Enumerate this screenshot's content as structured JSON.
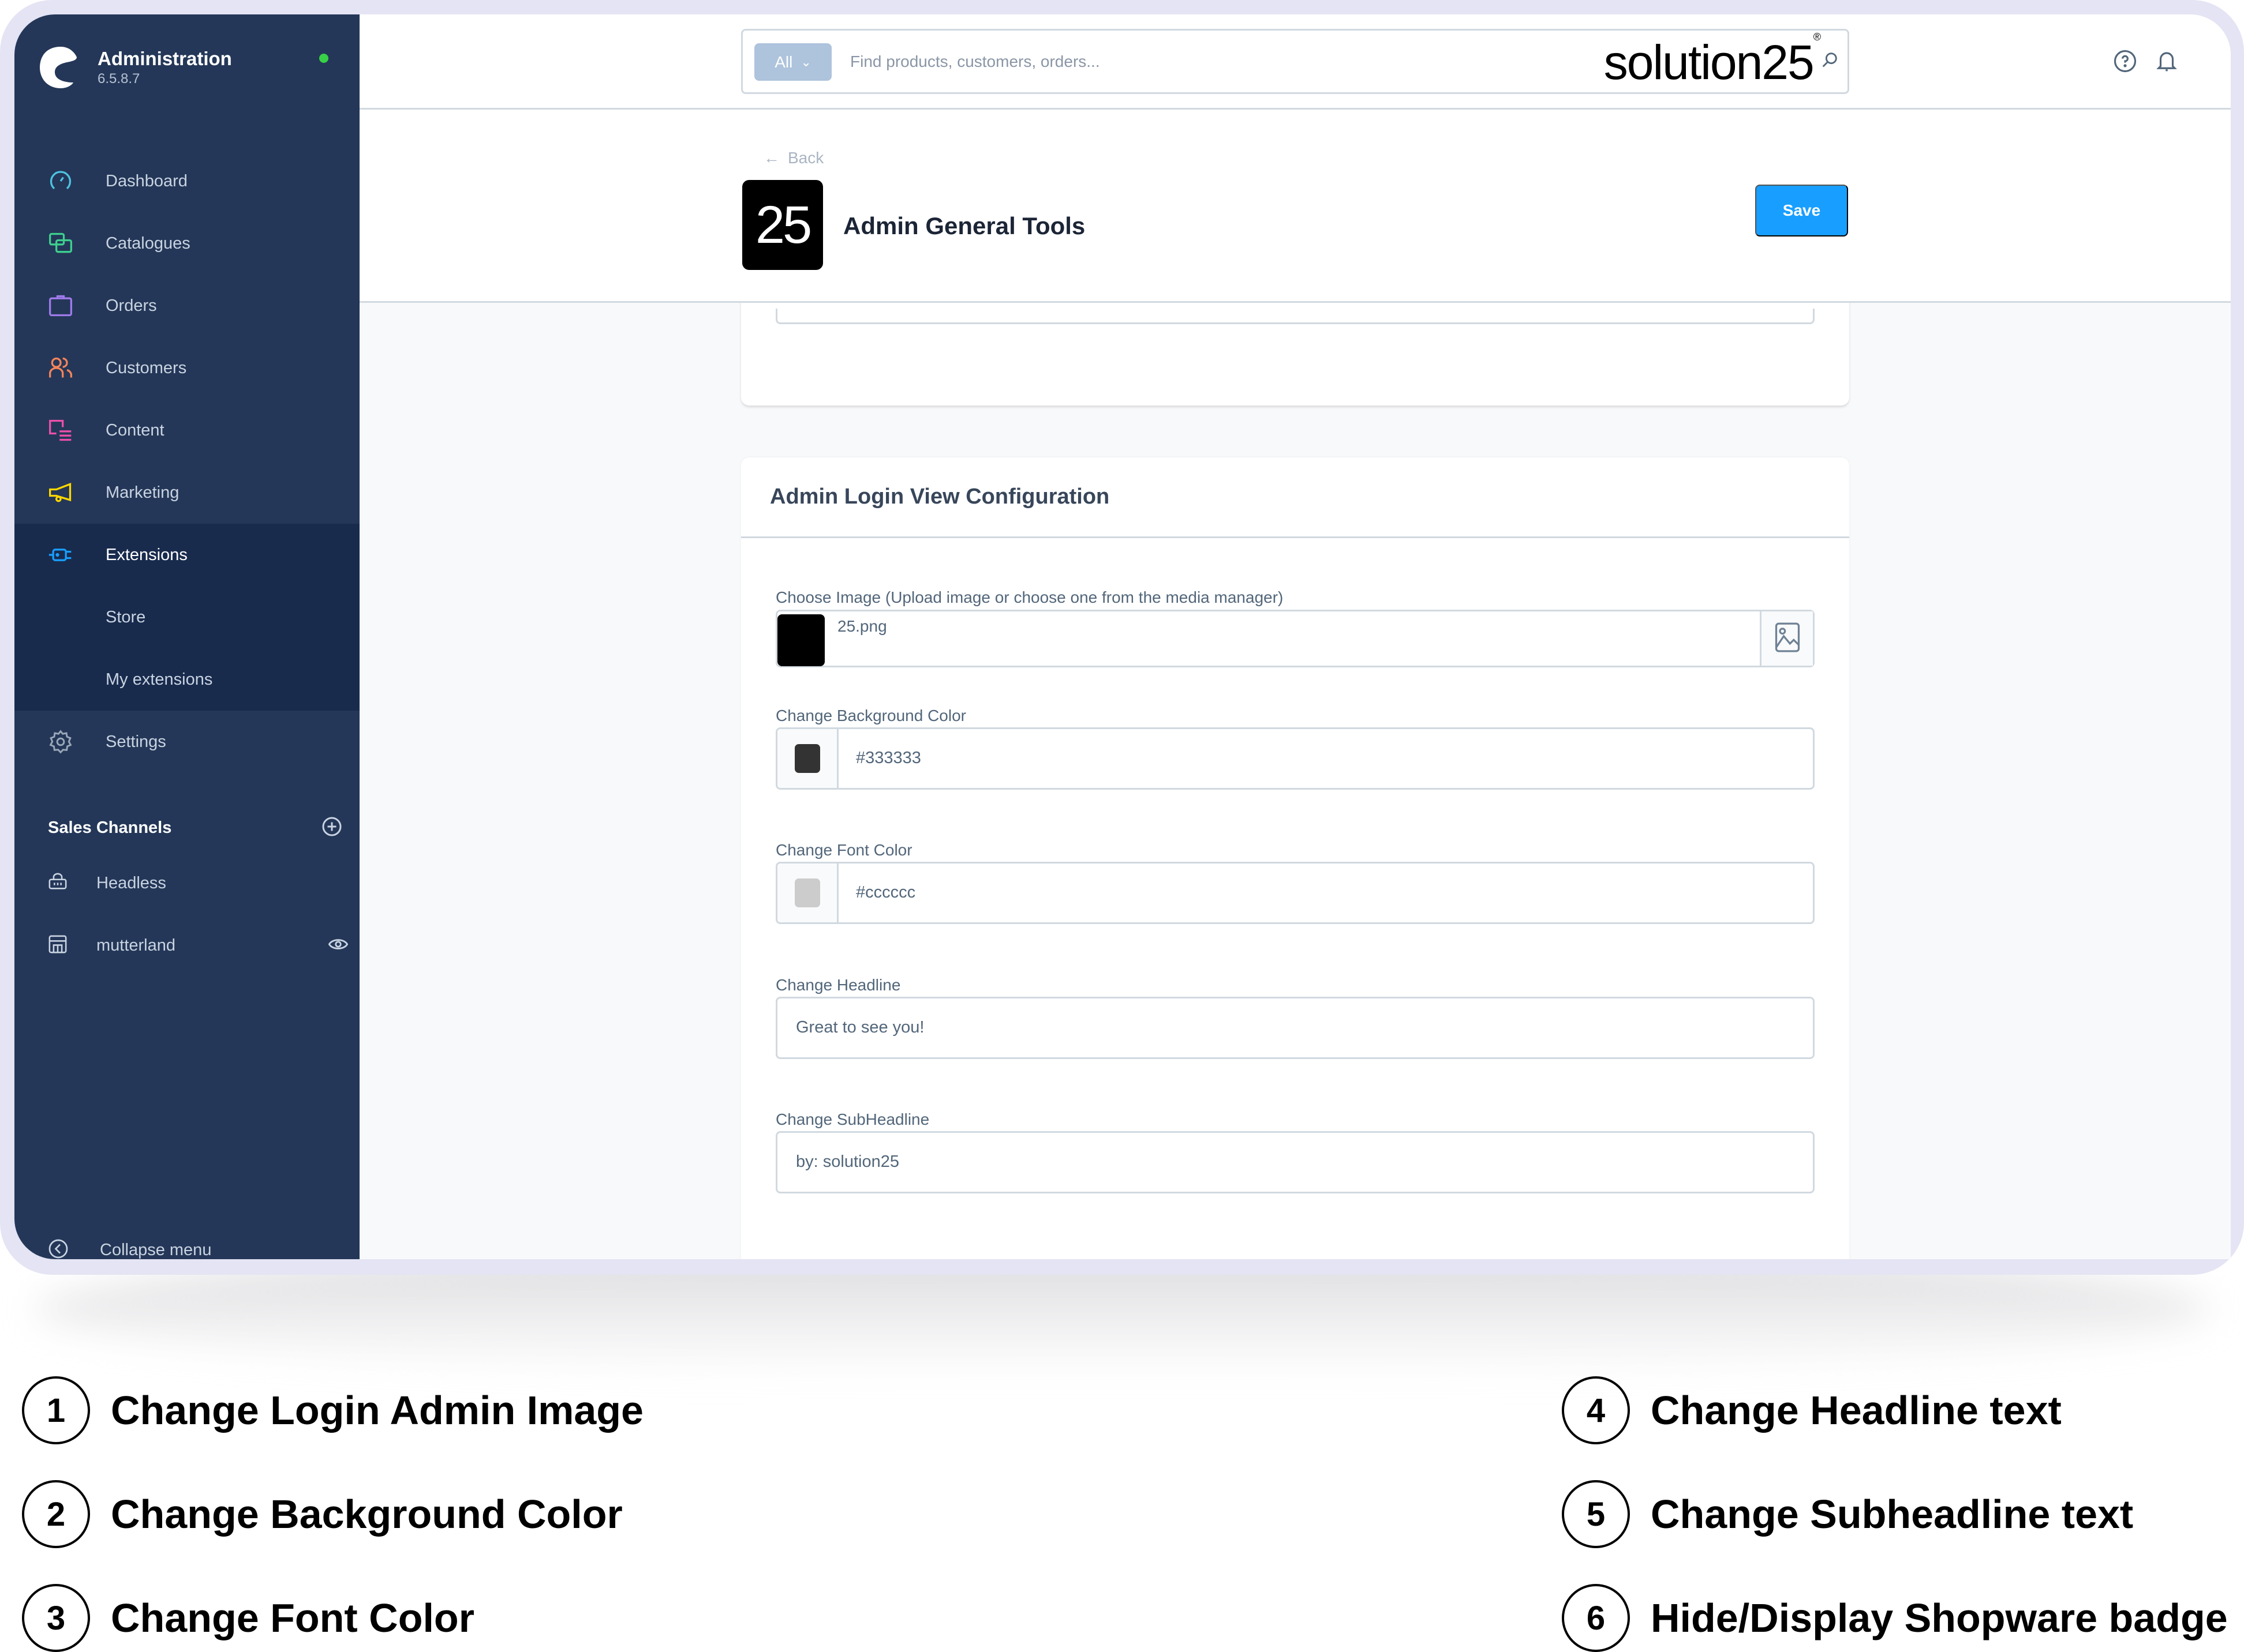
{
  "app": {
    "title": "Administration",
    "version": "6.5.8.7",
    "status_color": "#37d046"
  },
  "sidebar": {
    "items": [
      {
        "label": "Dashboard",
        "icon": "dashboard-icon",
        "color": "#4ec3e0"
      },
      {
        "label": "Catalogues",
        "icon": "catalogues-icon",
        "color": "#3ecf8e"
      },
      {
        "label": "Orders",
        "icon": "orders-icon",
        "color": "#9f7aea"
      },
      {
        "label": "Customers",
        "icon": "customers-icon",
        "color": "#f6845a"
      },
      {
        "label": "Content",
        "icon": "content-icon",
        "color": "#ec4fa9"
      },
      {
        "label": "Marketing",
        "icon": "marketing-icon",
        "color": "#ffd700"
      },
      {
        "label": "Extensions",
        "icon": "extensions-icon",
        "color": "#189eff",
        "active": true
      },
      {
        "label": "Store",
        "sub": true
      },
      {
        "label": "My extensions",
        "sub": true
      },
      {
        "label": "Settings",
        "icon": "settings-icon",
        "color": "#9aa8b8"
      }
    ],
    "sales_channels": {
      "title": "Sales Channels",
      "items": [
        {
          "label": "Headless",
          "icon": "basket-icon"
        },
        {
          "label": "mutterland",
          "icon": "storefront-icon"
        }
      ]
    },
    "collapse_label": "Collapse menu"
  },
  "topbar": {
    "search_type": "All",
    "search_placeholder": "Find products, customers, orders...",
    "watermark": "solution25",
    "watermark_mark": "®"
  },
  "page": {
    "back_label": "Back",
    "app_logo_text": "25",
    "title": "Admin General Tools",
    "save_label": "Save"
  },
  "config": {
    "title": "Admin Login View Configuration",
    "image_label": "Choose Image (Upload image or choose one from the media manager)",
    "image_name": "25.png",
    "bg_label": "Change Background Color",
    "bg_value": "#333333",
    "font_label": "Change Font Color",
    "font_value": "#cccccc",
    "headline_label": "Change Headline",
    "headline_value": "Great to see you!",
    "subheadline_label": "Change SubHeadline",
    "subheadline_value": "by: solution25",
    "badge_checked": true
  },
  "annotations": [
    {
      "num": "1",
      "text": "Change Login Admin Image"
    },
    {
      "num": "2",
      "text": "Change Background Color"
    },
    {
      "num": "3",
      "text": "Change Font Color"
    },
    {
      "num": "4",
      "text": "Change Headline text"
    },
    {
      "num": "5",
      "text": "Change Subheadline text"
    },
    {
      "num": "6",
      "text": "Hide/Display Shopware badge"
    }
  ]
}
